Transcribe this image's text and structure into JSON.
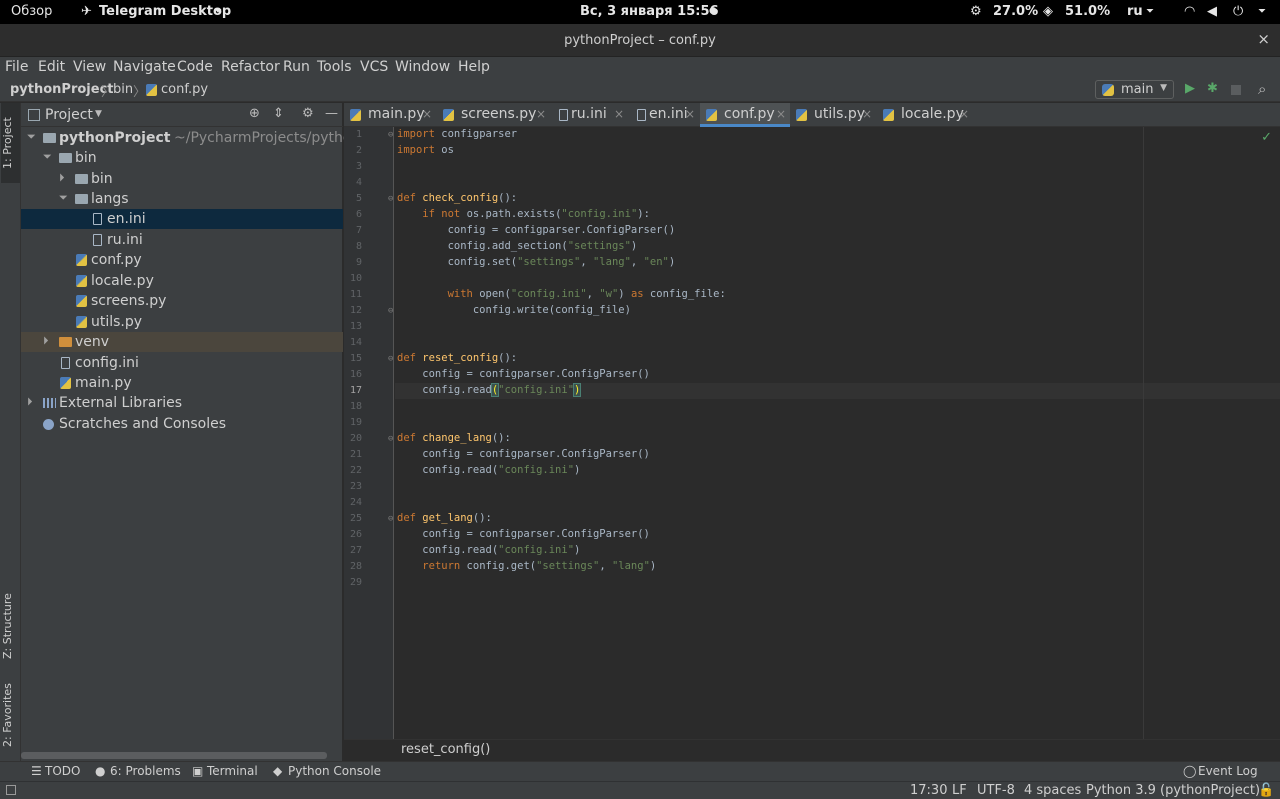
{
  "topbar": {
    "overview": "Обзор",
    "app_name": "Telegram Desktop",
    "app_arrow": "⏷",
    "clock": "Вс, 3 января  15:56",
    "dot": "●",
    "cpu": "27.0%",
    "mem": "51.0%",
    "lang": "ru",
    "lang_arrow": "⏷",
    "tray_arrow": "⏷"
  },
  "window": {
    "title": "pythonProject – conf.py",
    "close": "×"
  },
  "menu": [
    "File",
    "Edit",
    "View",
    "Navigate",
    "Code",
    "Refactor",
    "Run",
    "Tools",
    "VCS",
    "Window",
    "Help"
  ],
  "navbar": {
    "crumbs": [
      "pythonProject",
      "bin",
      "conf.py"
    ],
    "run_config": "main"
  },
  "side_tabs": {
    "project": "1: Project",
    "structure": "Z: Structure",
    "favorites": "2: Favorites"
  },
  "project_panel": {
    "title": "Project",
    "tree": [
      {
        "label": "pythonProject",
        "extra": "~/PycharmProjects/pythonProje",
        "arrow": "⏷",
        "icon": "folder-icon",
        "bold": true
      },
      {
        "label": "bin",
        "arrow": "⏷",
        "icon": "folder-icon"
      },
      {
        "label": "bin",
        "arrow": "⏵",
        "icon": "folder-icon"
      },
      {
        "label": "langs",
        "arrow": "⏷",
        "icon": "folder-icon"
      },
      {
        "label": "en.ini",
        "icon": "ini-file-icon",
        "selected": true
      },
      {
        "label": "ru.ini",
        "icon": "ini-file-icon"
      },
      {
        "label": "conf.py",
        "icon": "python-file-icon"
      },
      {
        "label": "locale.py",
        "icon": "python-file-icon"
      },
      {
        "label": "screens.py",
        "icon": "python-file-icon"
      },
      {
        "label": "utils.py",
        "icon": "python-file-icon"
      },
      {
        "label": "venv",
        "arrow": "⏵",
        "icon": "venv-folder-icon",
        "highlighted": true
      },
      {
        "label": "config.ini",
        "icon": "ini-file-icon"
      },
      {
        "label": "main.py",
        "icon": "python-file-icon"
      },
      {
        "label": "External Libraries",
        "arrow": "⏵",
        "icon": "libraries-icon"
      },
      {
        "label": "Scratches and Consoles",
        "icon": "scratches-icon"
      }
    ]
  },
  "tabs": [
    {
      "label": "main.py",
      "type": "py"
    },
    {
      "label": "screens.py",
      "type": "py"
    },
    {
      "label": "ru.ini",
      "type": "ini"
    },
    {
      "label": "en.ini",
      "type": "ini"
    },
    {
      "label": "conf.py",
      "type": "py",
      "active": true
    },
    {
      "label": "utils.py",
      "type": "py"
    },
    {
      "label": "locale.py",
      "type": "py"
    }
  ],
  "editor": {
    "current_line": 17,
    "line_numbers": [
      "1",
      "2",
      "3",
      "4",
      "5",
      "6",
      "7",
      "8",
      "9",
      "10",
      "11",
      "12",
      "13",
      "14",
      "15",
      "16",
      "17",
      "18",
      "19",
      "20",
      "21",
      "22",
      "23",
      "24",
      "25",
      "26",
      "27",
      "28",
      "29"
    ],
    "code_lines": [
      "import configparser",
      "import os",
      "",
      "",
      "def check_config():",
      "    if not os.path.exists(\"config.ini\"):",
      "        config = configparser.ConfigParser()",
      "        config.add_section(\"settings\")",
      "        config.set(\"settings\", \"lang\", \"en\")",
      "",
      "        with open(\"config.ini\", \"w\") as config_file:",
      "            config.write(config_file)",
      "",
      "",
      "def reset_config():",
      "    config = configparser.ConfigParser()",
      "    config.read(\"config.ini\")",
      "",
      "",
      "def change_lang():",
      "    config = configparser.ConfigParser()",
      "    config.read(\"config.ini\")",
      "",
      "",
      "def get_lang():",
      "    config = configparser.ConfigParser()",
      "    config.read(\"config.ini\")",
      "    return config.get(\"settings\", \"lang\")",
      ""
    ],
    "breadcrumb": "reset_config()"
  },
  "tool_windows": [
    {
      "label": "TODO",
      "icon": "todo-icon"
    },
    {
      "label": "6: Problems",
      "icon": "problems-icon"
    },
    {
      "label": "Terminal",
      "icon": "terminal-icon"
    },
    {
      "label": "Python Console",
      "icon": "python-console-icon"
    }
  ],
  "event_log": "Event Log",
  "status": {
    "position": "17:30",
    "line_sep": "LF",
    "encoding": "UTF-8",
    "indent": "4 spaces",
    "interpreter": "Python 3.9 (pythonProject)"
  }
}
